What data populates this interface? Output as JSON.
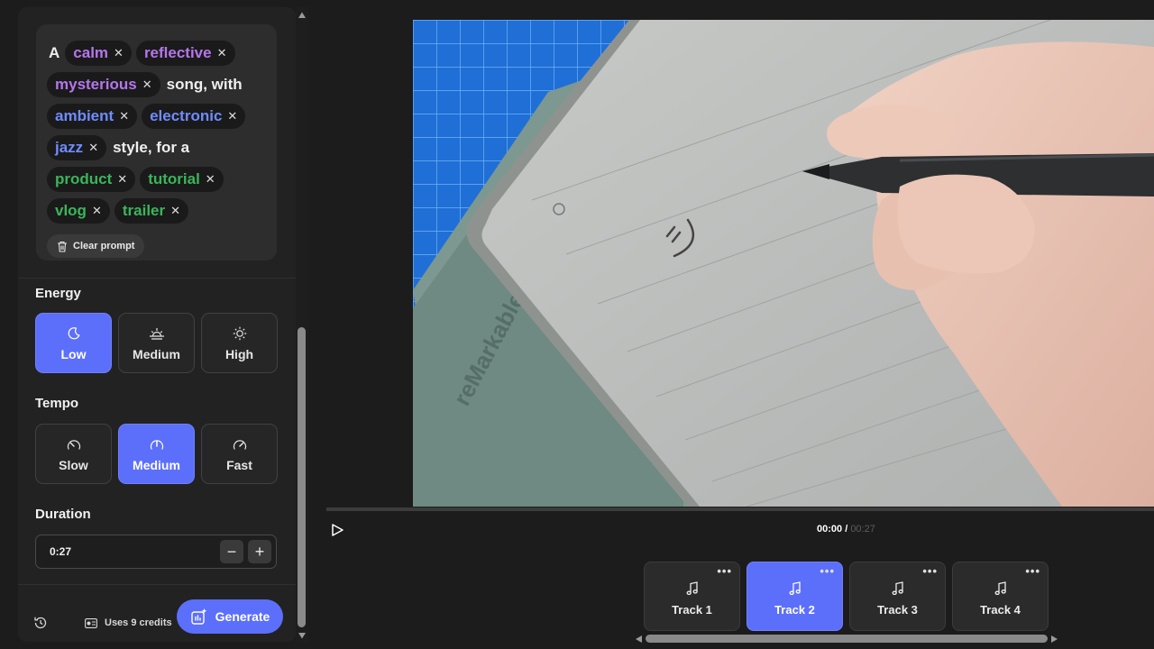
{
  "prompt": {
    "lines": [
      [
        {
          "kind": "text",
          "text": "A"
        },
        {
          "kind": "chip",
          "text": "calm",
          "color": "purple"
        },
        {
          "kind": "chip",
          "text": "reflective",
          "color": "purple"
        }
      ],
      [
        {
          "kind": "chip",
          "text": "mysterious",
          "color": "purple"
        },
        {
          "kind": "text",
          "text": "song, with"
        }
      ],
      [
        {
          "kind": "chip",
          "text": "ambient",
          "color": "blue"
        },
        {
          "kind": "chip",
          "text": "electronic",
          "color": "blue"
        }
      ],
      [
        {
          "kind": "chip",
          "text": "jazz",
          "color": "blue"
        },
        {
          "kind": "text",
          "text": "style, for a"
        }
      ],
      [
        {
          "kind": "chip",
          "text": "product",
          "color": "green"
        },
        {
          "kind": "chip",
          "text": "tutorial",
          "color": "green"
        }
      ],
      [
        {
          "kind": "chip",
          "text": "vlog",
          "color": "green"
        },
        {
          "kind": "chip",
          "text": "trailer",
          "color": "green"
        }
      ]
    ],
    "remove_glyph": "✕",
    "clear_label": "Clear prompt"
  },
  "energy": {
    "title": "Energy",
    "options": [
      {
        "label": "Low",
        "icon": "moon-icon",
        "active": true
      },
      {
        "label": "Medium",
        "icon": "sunrise-icon",
        "active": false
      },
      {
        "label": "High",
        "icon": "sun-icon",
        "active": false
      }
    ]
  },
  "tempo": {
    "title": "Tempo",
    "options": [
      {
        "label": "Slow",
        "icon": "gauge-slow-icon",
        "active": false
      },
      {
        "label": "Medium",
        "icon": "gauge-medium-icon",
        "active": true
      },
      {
        "label": "Fast",
        "icon": "gauge-fast-icon",
        "active": false
      }
    ]
  },
  "duration": {
    "title": "Duration",
    "value": "0:27",
    "decrement": "−",
    "increment": "+"
  },
  "footer": {
    "credits_label": "Uses 9 credits",
    "generate_label": "Generate"
  },
  "player": {
    "current_time": "00:00",
    "separator": " / ",
    "duration_time": "00:27",
    "progress": 0
  },
  "tracks": [
    {
      "label": "Track 1",
      "active": false
    },
    {
      "label": "Track 2",
      "active": true
    },
    {
      "label": "Track 3",
      "active": false
    },
    {
      "label": "Track 4",
      "active": false
    }
  ],
  "more_glyph": "•••",
  "colors": {
    "accent": "#5c6ffb",
    "chip_purple": "#b576ec",
    "chip_blue": "#6f8cff",
    "chip_green": "#3bb55a"
  }
}
